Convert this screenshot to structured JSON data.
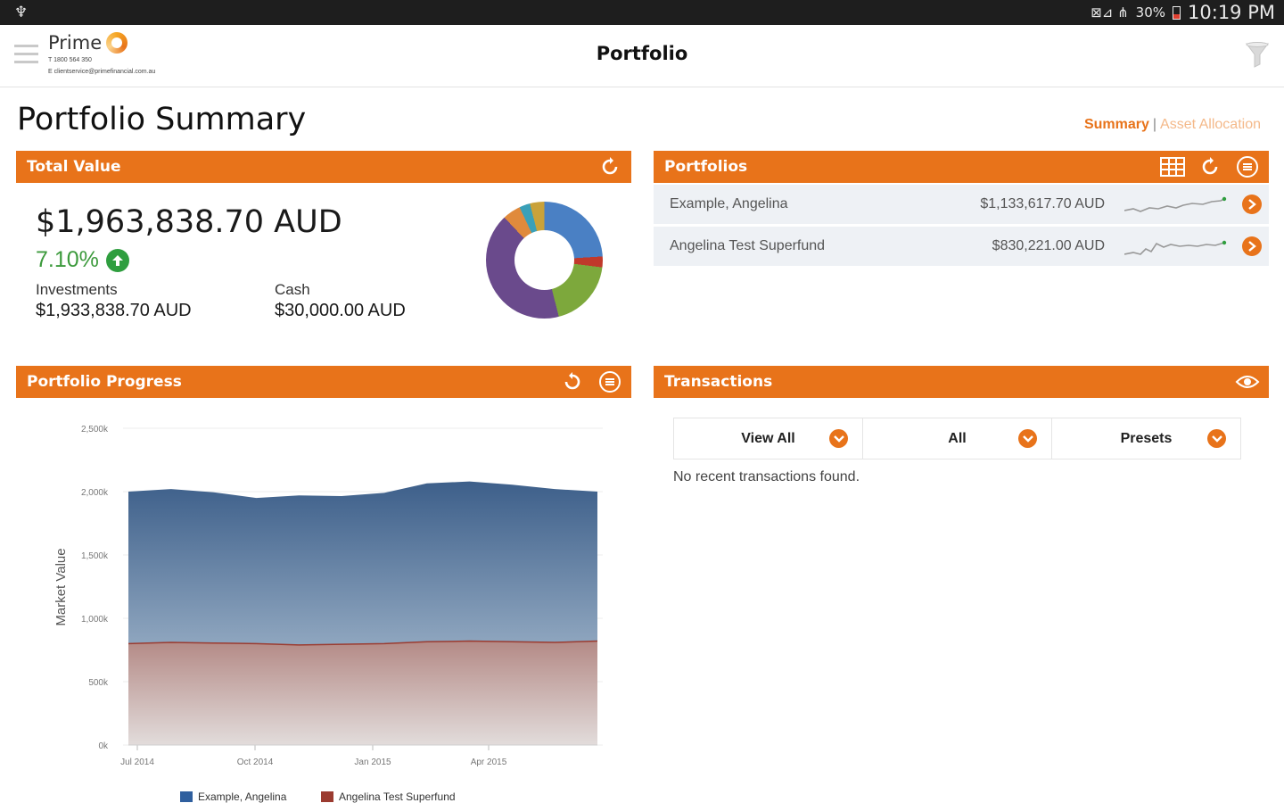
{
  "status_bar": {
    "usb_symbol": "♆",
    "left_icons": "⊠⊿ ⋔",
    "battery": "30%",
    "time": "10:19 PM"
  },
  "app_bar": {
    "brand": "Prime",
    "contact_phone": "T 1800 564 350",
    "contact_email": "E clientservice@primefinancial.com.au",
    "title": "Portfolio"
  },
  "page": {
    "title": "Portfolio Summary",
    "links": {
      "summary": "Summary",
      "separator": "|",
      "asset_allocation": "Asset Allocation"
    }
  },
  "total_value": {
    "header": "Total Value",
    "amount": "$1,963,838.70 AUD",
    "change": "7.10%",
    "investments_label": "Investments",
    "investments_value": "$1,933,838.70 AUD",
    "cash_label": "Cash",
    "cash_value": "$30,000.00 AUD",
    "allocation_colors": [
      "#4a80c4",
      "#c0392b",
      "#7da83c",
      "#6a4a8c",
      "#e08a3c",
      "#3aa0b8",
      "#c9a23a"
    ]
  },
  "portfolios": {
    "header": "Portfolios",
    "rows": [
      {
        "name": "Example, Angelina",
        "amount": "$1,133,617.70 AUD"
      },
      {
        "name": "Angelina Test Superfund",
        "amount": "$830,221.00 AUD"
      }
    ]
  },
  "progress": {
    "header": "Portfolio Progress"
  },
  "transactions": {
    "header": "Transactions",
    "filters": [
      "View All",
      "All",
      "Presets"
    ],
    "empty_message": "No recent transactions found."
  },
  "chart_data": {
    "type": "area",
    "stacked": true,
    "ylabel": "Market Value",
    "xlabel": "",
    "ylim": [
      0,
      2500000
    ],
    "y_ticks": [
      "0k",
      "500k",
      "1,000k",
      "1,500k",
      "2,000k",
      "2,500k"
    ],
    "x_ticks": [
      "Jul 2014",
      "Oct 2014",
      "Jan 2015",
      "Apr 2015"
    ],
    "x": [
      "2014-07-01",
      "2014-08-01",
      "2014-09-01",
      "2014-10-01",
      "2014-11-01",
      "2014-12-01",
      "2015-01-01",
      "2015-02-01",
      "2015-03-01",
      "2015-04-01",
      "2015-05-01",
      "2015-06-01"
    ],
    "series": [
      {
        "name": "Example, Angelina",
        "color": "#3d5f8a",
        "values": [
          1200000,
          1210000,
          1190000,
          1150000,
          1180000,
          1170000,
          1190000,
          1250000,
          1260000,
          1240000,
          1210000,
          1180000
        ]
      },
      {
        "name": "Angelina Test Superfund",
        "color": "#9b3b30",
        "values": [
          800000,
          810000,
          805000,
          800000,
          790000,
          795000,
          800000,
          815000,
          820000,
          815000,
          810000,
          820000
        ]
      }
    ],
    "grid": true,
    "legend": "bottom"
  }
}
